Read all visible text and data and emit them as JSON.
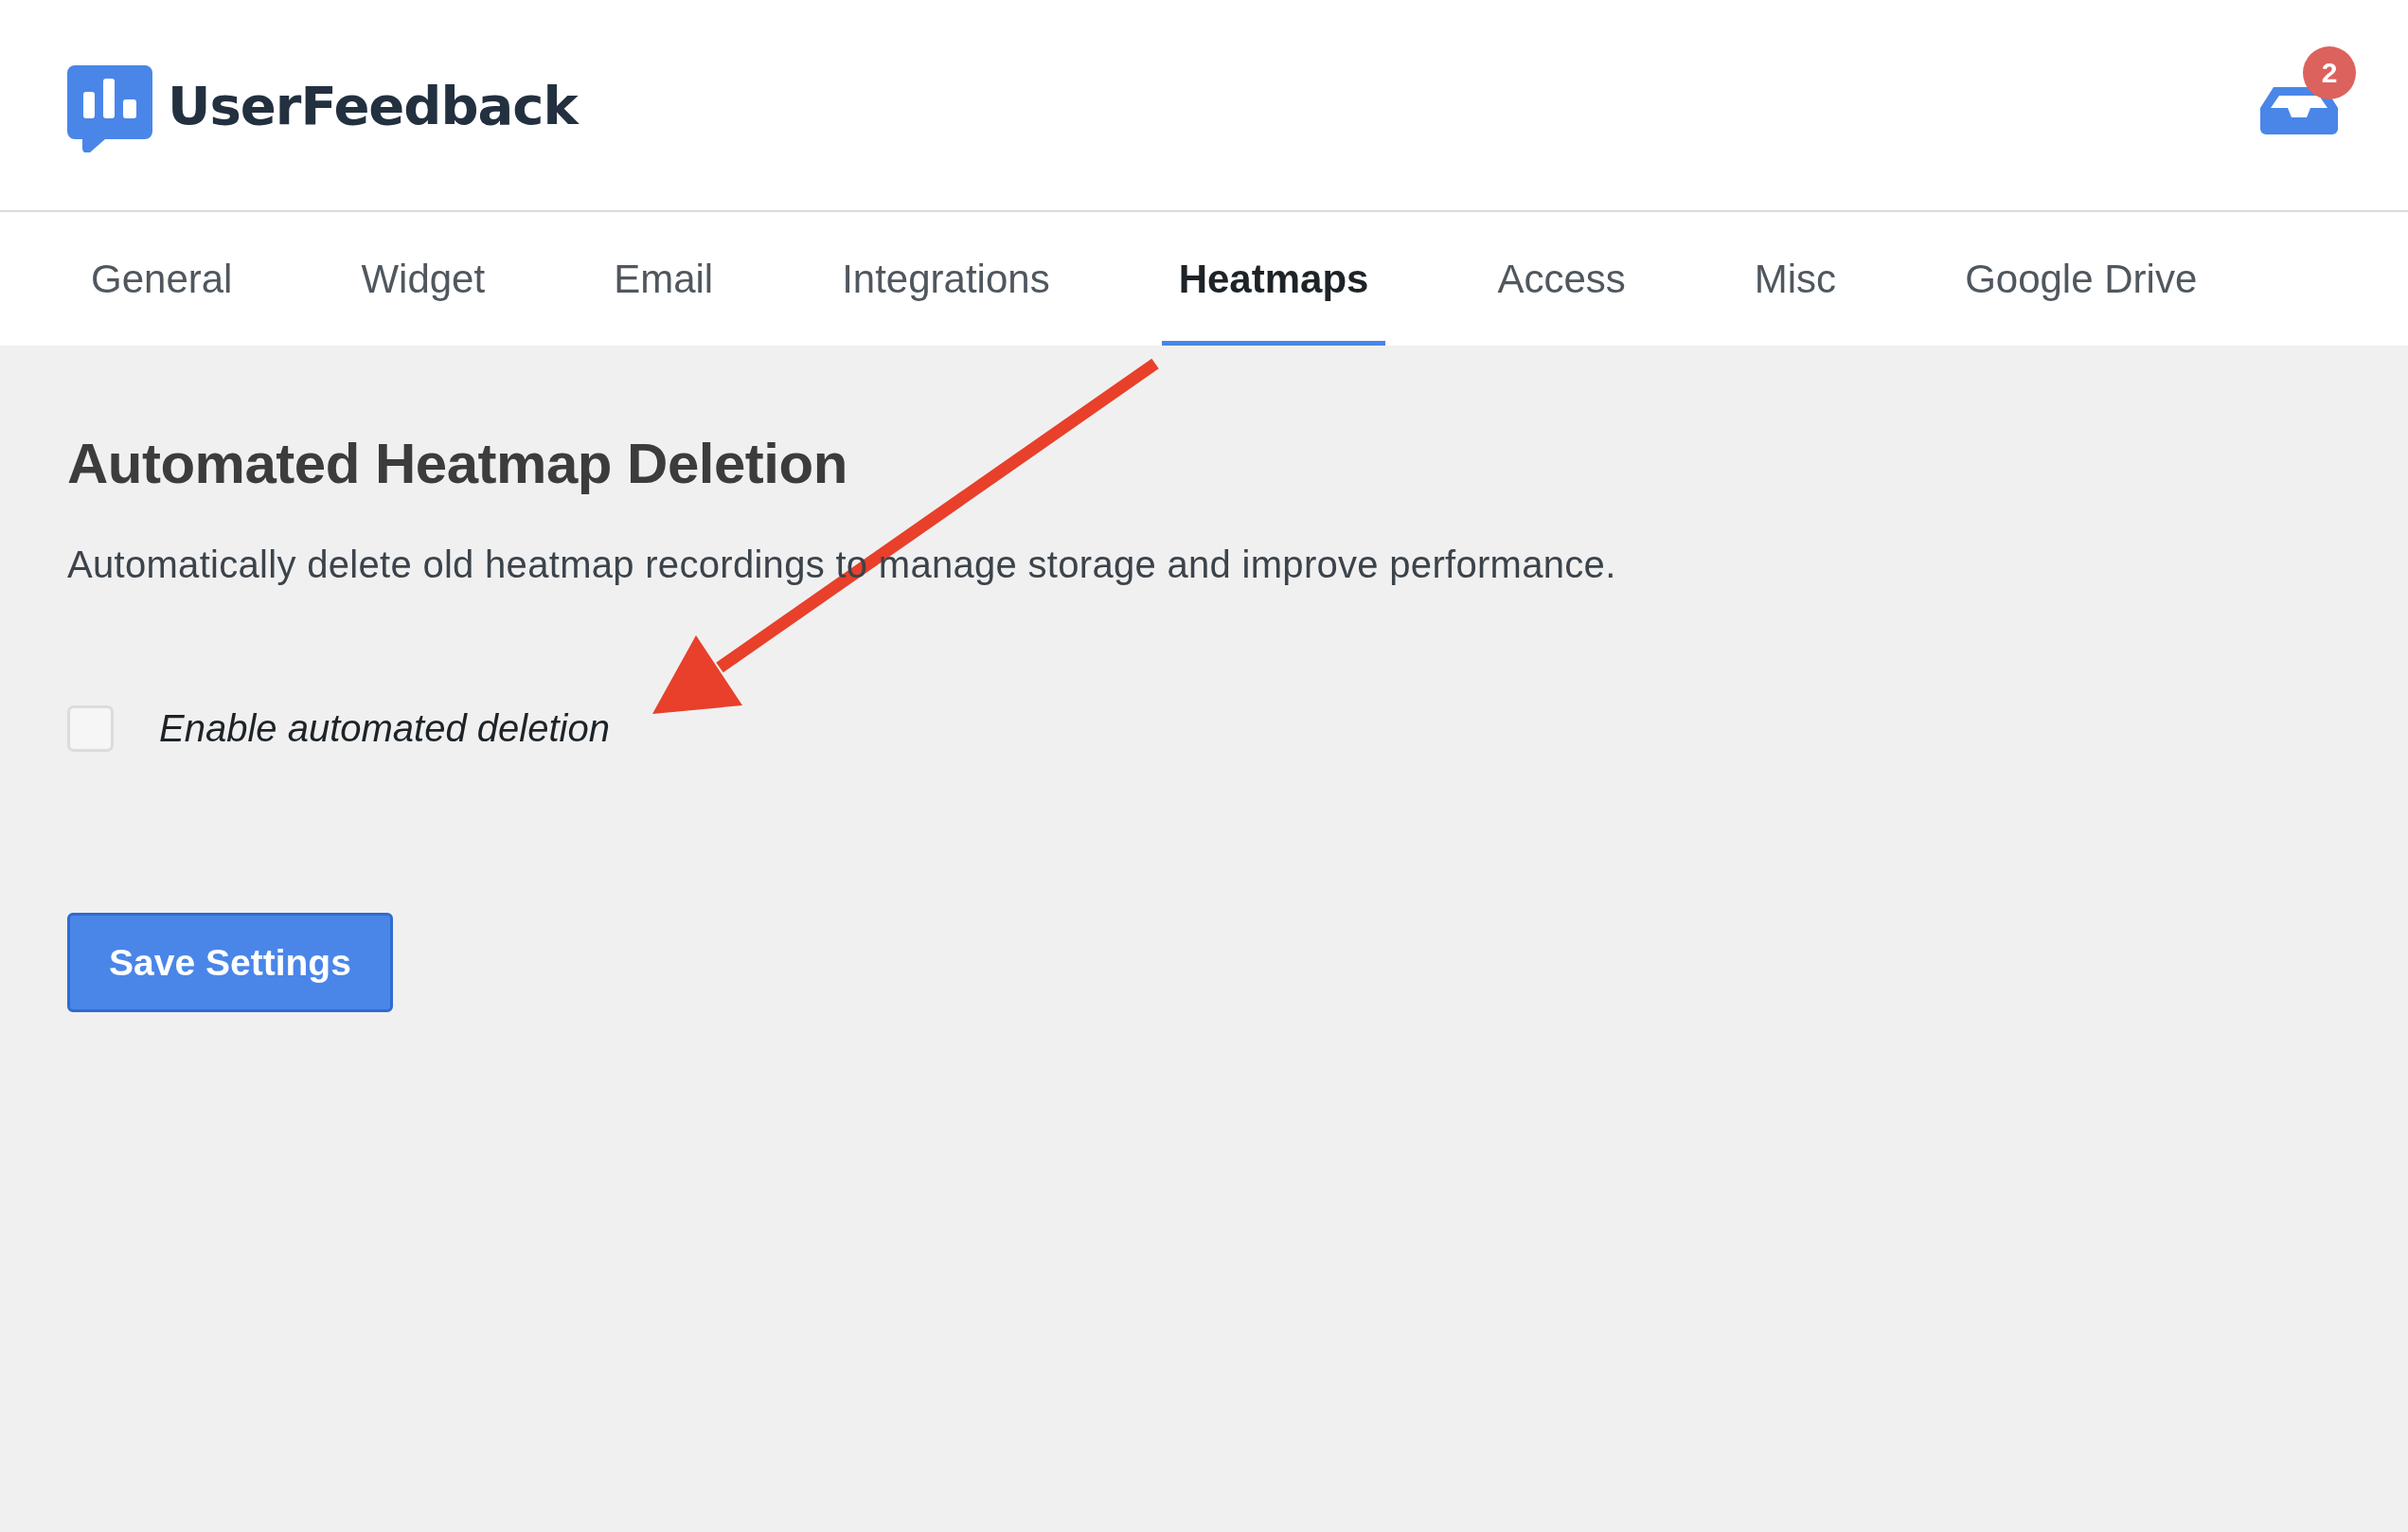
{
  "header": {
    "logo_text": "UserFeedback",
    "notification_count": "2"
  },
  "tabs": [
    {
      "label": "General",
      "selected": false
    },
    {
      "label": "Widget",
      "selected": false
    },
    {
      "label": "Email",
      "selected": false
    },
    {
      "label": "Integrations",
      "selected": false
    },
    {
      "label": "Heatmaps",
      "selected": true
    },
    {
      "label": "Access",
      "selected": false
    },
    {
      "label": "Misc",
      "selected": false
    },
    {
      "label": "Google Drive",
      "selected": false
    }
  ],
  "section": {
    "title": "Automated Heatmap Deletion",
    "description": "Automatically delete old heatmap recordings to manage storage and improve performance.",
    "options": [
      {
        "label": "Enable automated deletion",
        "checked": false
      }
    ]
  },
  "save_button": {
    "label": "Save Settings"
  }
}
